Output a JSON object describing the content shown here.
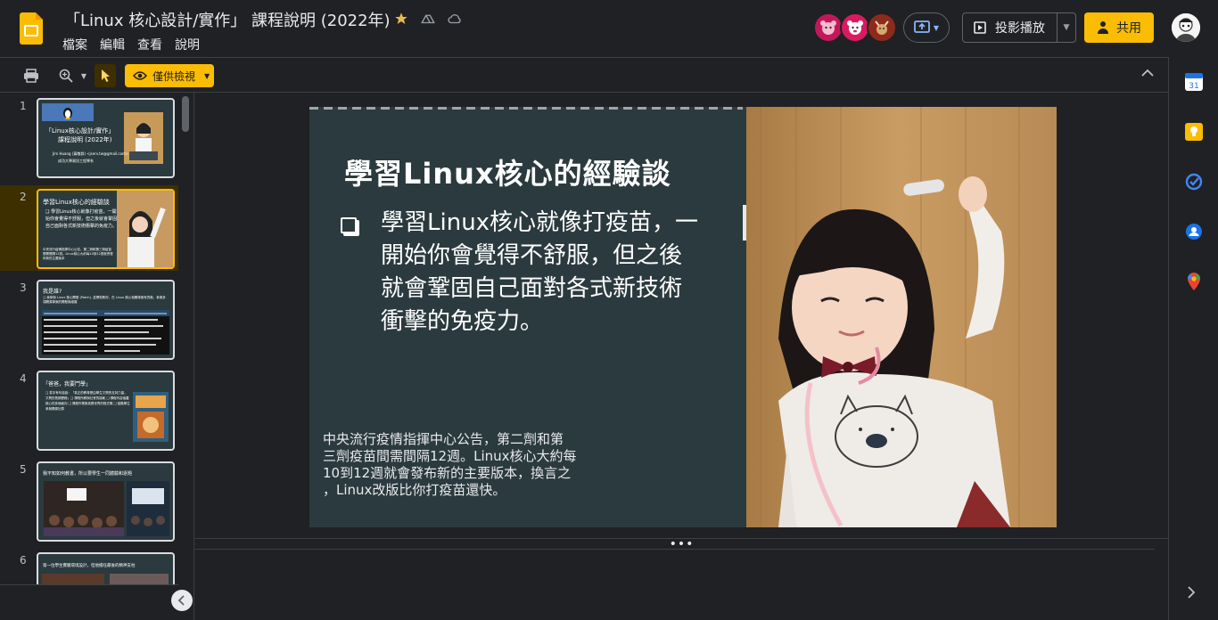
{
  "app": {
    "logo_icon": "google-slides-icon",
    "accent": "#fbbc04"
  },
  "document": {
    "title": "「Linux 核心設計/實作」 課程說明 (2022年)"
  },
  "menu": [
    {
      "label": "檔案"
    },
    {
      "label": "編輯"
    },
    {
      "label": "查看"
    },
    {
      "label": "說明"
    }
  ],
  "header": {
    "slideshow_label": "投影播放",
    "share_label": "共用"
  },
  "toolbar": {
    "view_only_label": "僅供檢視"
  },
  "filmstrip": {
    "selected": 2,
    "slides": [
      {
        "number": "1"
      },
      {
        "number": "2"
      },
      {
        "number": "3"
      },
      {
        "number": "4"
      },
      {
        "number": "5"
      },
      {
        "number": "6"
      }
    ]
  },
  "slide": {
    "title": "學習Linux核心的經驗談",
    "bullet_lines": [
      "學習Linux核心就像打疫苗，一",
      "開始你會覺得不舒服，但之後",
      "就會鞏固自己面對各式新技術",
      "衝擊的免疫力。"
    ],
    "note_lines": [
      "中央流行疫情指揮中心公告，第二劑和第",
      "三劑疫苗間需間隔12週。Linux核心大約每",
      "10到12週就會發布新的主要版本，換言之",
      "，Linux改版比你打疫苗還快。"
    ],
    "background": "#2b3a3e"
  }
}
